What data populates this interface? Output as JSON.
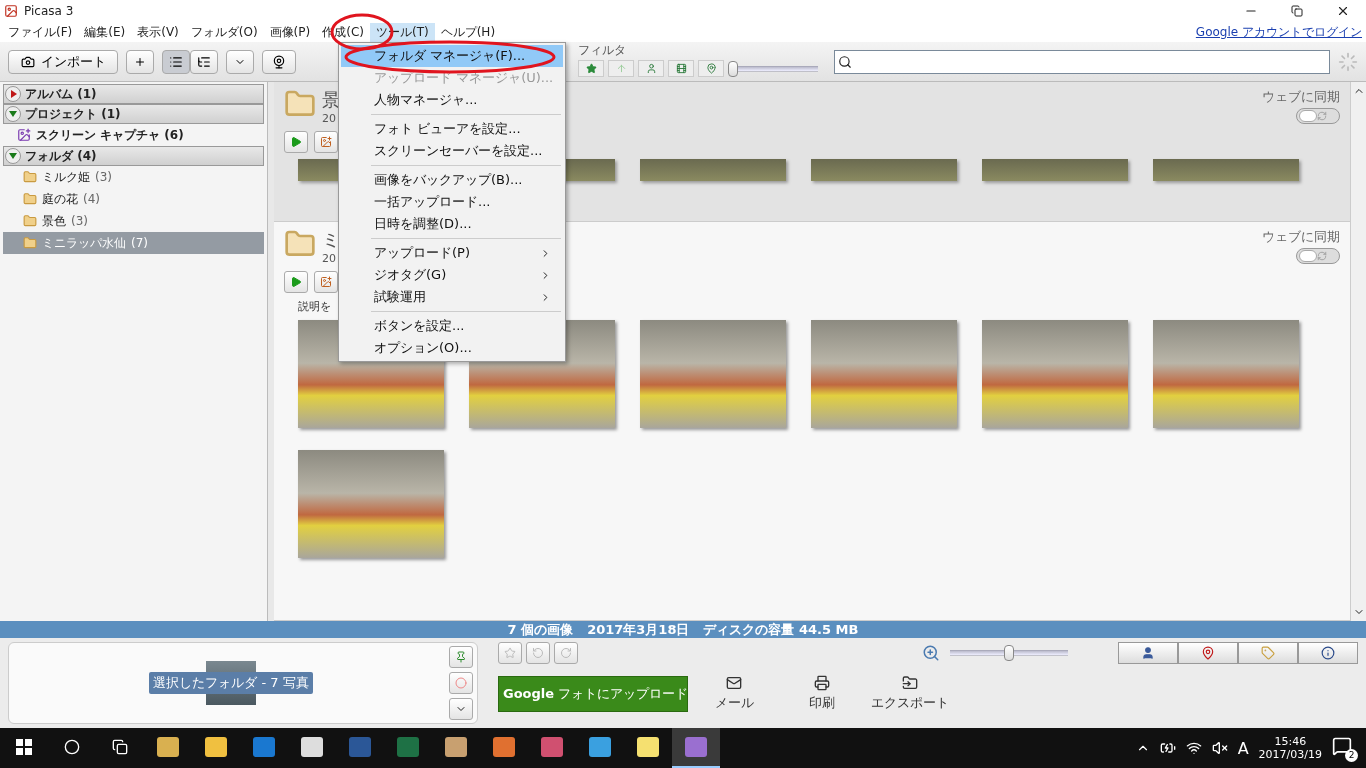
{
  "window": {
    "title": "Picasa 3"
  },
  "menubar": [
    {
      "label": "ファイル(F)",
      "selected": false
    },
    {
      "label": "編集(E)",
      "selected": false
    },
    {
      "label": "表示(V)",
      "selected": false
    },
    {
      "label": "フォルダ(O)",
      "selected": false
    },
    {
      "label": "画像(P)",
      "selected": false
    },
    {
      "label": "作成(C)",
      "selected": false
    },
    {
      "label": "ツール(T)",
      "selected": true
    },
    {
      "label": "ヘルプ(H)",
      "selected": false
    }
  ],
  "account_link": "Google アカウントでログイン",
  "toolbar": {
    "import_label": "インポート",
    "views": [
      {
        "kind": "list",
        "selected": true
      },
      {
        "kind": "tree",
        "selected": false
      }
    ],
    "filter_label": "フィルタ",
    "filter_slider": {
      "level": 0.0
    }
  },
  "menu": [
    {
      "kind": "item",
      "label": "フォルダ マネージャ(F)...",
      "selected": true,
      "disabled": false,
      "submenu": false
    },
    {
      "kind": "item",
      "label": "アップロード マネージャ(U)...",
      "selected": false,
      "disabled": true,
      "submenu": false
    },
    {
      "kind": "item",
      "label": "人物マネージャ...",
      "selected": false,
      "disabled": false,
      "submenu": false
    },
    {
      "kind": "separator"
    },
    {
      "kind": "item",
      "label": "フォト ビューアを設定...",
      "selected": false,
      "disabled": false,
      "submenu": false
    },
    {
      "kind": "item",
      "label": "スクリーンセーバーを設定...",
      "selected": false,
      "disabled": false,
      "submenu": false
    },
    {
      "kind": "separator"
    },
    {
      "kind": "item",
      "label": "画像をバックアップ(B)...",
      "selected": false,
      "disabled": false,
      "submenu": false
    },
    {
      "kind": "item",
      "label": "一括アップロード...",
      "selected": false,
      "disabled": false,
      "submenu": false
    },
    {
      "kind": "item",
      "label": "日時を調整(D)...",
      "selected": false,
      "disabled": false,
      "submenu": false
    },
    {
      "kind": "separator"
    },
    {
      "kind": "item",
      "label": "アップロード(P)",
      "selected": false,
      "disabled": false,
      "submenu": true
    },
    {
      "kind": "item",
      "label": "ジオタグ(G)",
      "selected": false,
      "disabled": false,
      "submenu": true
    },
    {
      "kind": "item",
      "label": "試験運用",
      "selected": false,
      "disabled": false,
      "submenu": true
    },
    {
      "kind": "separator"
    },
    {
      "kind": "item",
      "label": "ボタンを設定...",
      "selected": false,
      "disabled": false,
      "submenu": false
    },
    {
      "kind": "item",
      "label": "オプション(O)...",
      "selected": false,
      "disabled": false,
      "submenu": false
    }
  ],
  "sidebar": [
    {
      "label": "アルバム (1)",
      "expanded": false
    },
    {
      "label": "プロジェクト (1)",
      "expanded": true,
      "children": [
        {
          "kind": "project",
          "name": "スクリーン キャプチャ (6)",
          "selected": false
        }
      ]
    },
    {
      "label": "フォルダ (4)",
      "expanded": true,
      "children": [
        {
          "kind": "folder",
          "name": "ミルク姫",
          "count": "(3)",
          "selected": false
        },
        {
          "kind": "folder",
          "name": "庭の花",
          "count": "(4)",
          "selected": false
        },
        {
          "kind": "folder",
          "name": "景色",
          "count": "(3)",
          "selected": false
        },
        {
          "kind": "folder",
          "name": "ミニラッパ水仙",
          "count": "(7)",
          "selected": true
        }
      ]
    }
  ],
  "sections": [
    {
      "title": "景",
      "date": "20",
      "sync_label": "ウェブに同期",
      "sync_on": false,
      "selected": true
    },
    {
      "title": "ミ",
      "date": "20",
      "sync_label": "ウェブに同期",
      "sync_on": false,
      "selected": false,
      "description": "説明を"
    }
  ],
  "status_bar": [
    "7 個の画像",
    "2017年3月18日",
    "ディスクの容量 **44.5 MB**"
  ],
  "tray": {
    "label": "選択したフォルダ - 7 写真"
  },
  "zoom_slider": {
    "level": 0.5
  },
  "upload_button": "**Google** フォトにアップロード",
  "actions": [
    {
      "kind": "mail",
      "label": "メール"
    },
    {
      "kind": "print",
      "label": "印刷"
    },
    {
      "kind": "export",
      "label": "エクスポート"
    }
  ],
  "taskbar": {
    "apps": [
      {
        "kind": "mail",
        "selected": false
      },
      {
        "kind": "explorer",
        "selected": false
      },
      {
        "kind": "edge",
        "selected": false
      },
      {
        "kind": "store",
        "selected": false
      },
      {
        "kind": "word",
        "selected": false
      },
      {
        "kind": "excel",
        "selected": false
      },
      {
        "kind": "paint",
        "selected": false
      },
      {
        "kind": "toolbox",
        "selected": false
      },
      {
        "kind": "snip",
        "selected": false
      },
      {
        "kind": "ie",
        "selected": false
      },
      {
        "kind": "notes",
        "selected": false
      },
      {
        "kind": "picasa",
        "selected": true
      }
    ],
    "ime": "A",
    "time": "15:46",
    "date": "2017/03/19",
    "notifications": "2"
  }
}
